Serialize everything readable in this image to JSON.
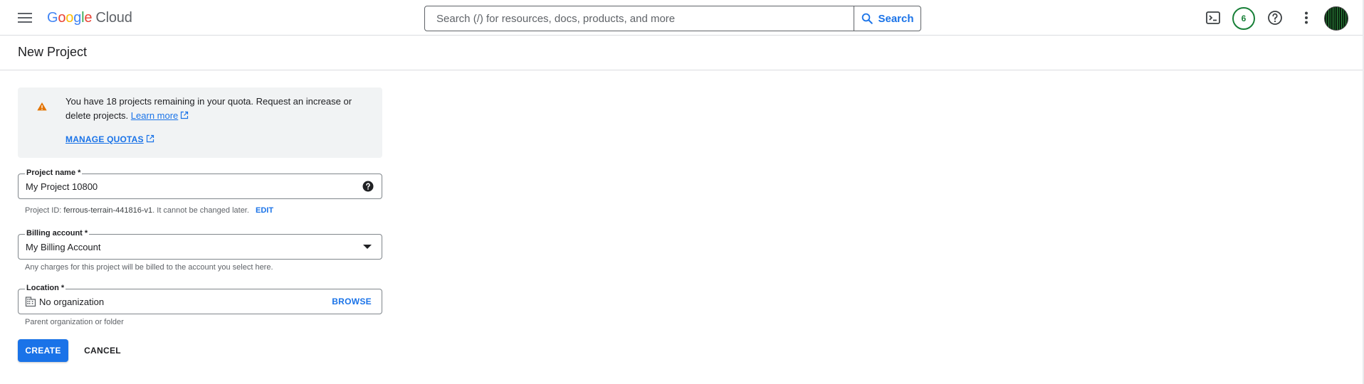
{
  "header": {
    "logo_parts": [
      "G",
      "o",
      "o",
      "g",
      "l",
      "e"
    ],
    "logo_suffix": "Cloud",
    "search_placeholder": "Search (/) for resources, docs, products, and more",
    "search_button": "Search",
    "notification_count": "6",
    "icons": [
      "menu-icon",
      "search-icon",
      "cloud-shell-icon",
      "help-icon",
      "more-vert-icon"
    ]
  },
  "page": {
    "title": "New Project"
  },
  "banner": {
    "text_before_link": "You have 18 projects remaining in your quota. Request an increase or delete projects.",
    "learn_more": "Learn more",
    "manage_quotas": "MANAGE QUOTAS"
  },
  "form": {
    "project_name": {
      "label": "Project name *",
      "value": "My Project 10800",
      "hint_prefix": "Project ID:",
      "project_id": "ferrous-terrain-441816-v1",
      "hint_suffix": ". It cannot be changed later.",
      "edit": "EDIT"
    },
    "billing": {
      "label": "Billing account *",
      "value": "My Billing Account",
      "hint": "Any charges for this project will be billed to the account you select here."
    },
    "location": {
      "label": "Location *",
      "value": "No organization",
      "browse": "BROWSE",
      "hint": "Parent organization or folder"
    }
  },
  "actions": {
    "create": "CREATE",
    "cancel": "CANCEL"
  },
  "colors": {
    "accent": "#1a73e8",
    "warning": "#e37400",
    "notification": "#188038"
  }
}
